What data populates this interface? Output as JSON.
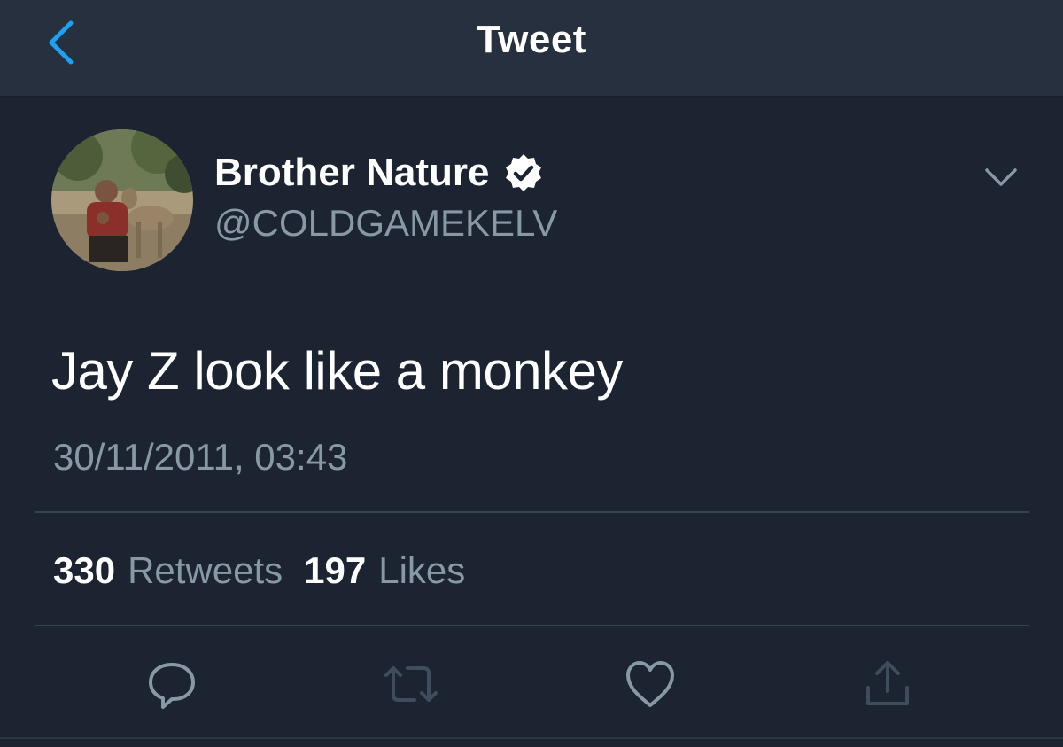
{
  "navbar": {
    "title": "Tweet"
  },
  "tweet": {
    "display_name": "Brother Nature",
    "handle": "@COLDGAMEKELV",
    "verified": true,
    "text": "Jay Z look like a monkey",
    "timestamp": "30/11/2011, 03:43"
  },
  "stats": {
    "retweets_count": "330",
    "retweets_label": "Retweets",
    "likes_count": "197",
    "likes_label": "Likes"
  },
  "actions": [
    {
      "name": "reply",
      "icon": "reply-icon"
    },
    {
      "name": "retweet",
      "icon": "retweet-icon"
    },
    {
      "name": "like",
      "icon": "heart-icon"
    },
    {
      "name": "share",
      "icon": "share-icon"
    }
  ],
  "colors": {
    "background": "#1c2431",
    "navbar": "#27303f",
    "accent": "#1da1f2",
    "secondary_text": "#8899a6",
    "primary_text": "#ffffff",
    "divider": "#38434f"
  }
}
